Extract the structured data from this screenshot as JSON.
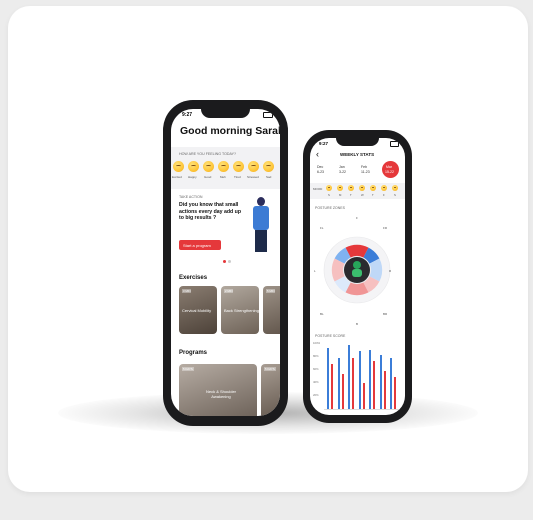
{
  "left_phone": {
    "status_time": "9:27",
    "greeting": "Good morning Sarah",
    "mood_question": "HOW ARE YOU FEELING TODAY?",
    "moods": [
      "Excited",
      "Happy",
      "Good",
      "Meh",
      "Tired",
      "Stressed",
      "Sad"
    ],
    "take_action_label": "TAKE ACTION",
    "take_action_text": "Did you know that small actions every day add up to big results ?",
    "start_program_button": "Start a program",
    "exercises_heading": "Exercises",
    "exercise_cards": [
      {
        "badge": "3 MIN",
        "title": "Cervical Mobility"
      },
      {
        "badge": "2 MIN",
        "title": "Back Strengthening"
      },
      {
        "badge": "5 MIN",
        "title": ""
      }
    ],
    "programs_heading": "Programs",
    "program_cards": [
      {
        "badge": "5 DAYS",
        "title": "Neck & Shoulder Awakening"
      },
      {
        "badge": "5 DAYS",
        "title": ""
      }
    ]
  },
  "right_phone": {
    "status_time": "9:27",
    "title": "WEEKLY STATS",
    "weeks": [
      {
        "month": "Dec",
        "range": "6-23"
      },
      {
        "month": "Jan",
        "range": "3-22"
      },
      {
        "month": "Feb",
        "range": "11-23"
      },
      {
        "month": "Mar",
        "range": "15-22"
      }
    ],
    "mood_label": "MOOD",
    "days": [
      "S",
      "M",
      "T",
      "W",
      "T",
      "F",
      "S"
    ],
    "posture_zones_label": "POSTURE ZONES",
    "zone_labels": [
      "F",
      "FR",
      "R",
      "BR",
      "B",
      "BL",
      "L",
      "FL"
    ],
    "posture_score_label": "POSTURE SCORE",
    "score_axis": [
      "100%",
      "80%",
      "60%",
      "40%",
      "20%"
    ],
    "chart_data": {
      "type": "bar",
      "series": [
        {
          "values": [
            95,
            80,
            100,
            90,
            92,
            85,
            80
          ]
        },
        {
          "values": [
            70,
            55,
            80,
            40,
            75,
            60,
            50
          ]
        }
      ],
      "ylim": [
        0,
        100
      ]
    },
    "colors": {
      "accent": "#e5383b",
      "blue": "#3b7dd8"
    }
  }
}
